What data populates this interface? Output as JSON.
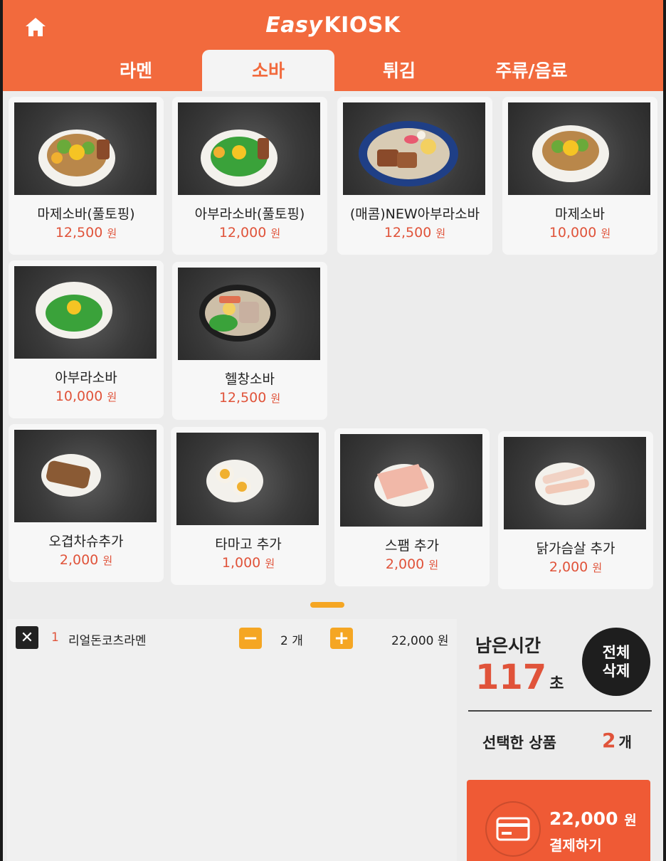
{
  "brand": {
    "easy": "Easy",
    "kiosk": "KIOSK"
  },
  "colors": {
    "accent": "#f26a3d",
    "price": "#e0533a",
    "qty_button": "#f5a623"
  },
  "tabs": [
    {
      "label": "라멘",
      "active": false
    },
    {
      "label": "소바",
      "active": true
    },
    {
      "label": "튀김",
      "active": false
    },
    {
      "label": "주류/음료",
      "active": false
    }
  ],
  "menu": [
    {
      "name": "마제소바(풀토핑)",
      "price": "12,500",
      "unit": "원"
    },
    {
      "name": "아부라소바(풀토핑)",
      "price": "12,000",
      "unit": "원"
    },
    {
      "name": "(매콤)NEW아부라소바",
      "price": "12,500",
      "unit": "원"
    },
    {
      "name": "마제소바",
      "price": "10,000",
      "unit": "원"
    },
    {
      "name": "아부라소바",
      "price": "10,000",
      "unit": "원"
    },
    {
      "name": "헬창소바",
      "price": "12,500",
      "unit": "원"
    },
    {
      "name": "오겹차슈추가",
      "price": "2,000",
      "unit": "원"
    },
    {
      "name": "타마고 추가",
      "price": "1,000",
      "unit": "원"
    },
    {
      "name": "스팸 추가",
      "price": "2,000",
      "unit": "원"
    },
    {
      "name": "닭가슴살 추가",
      "price": "2,000",
      "unit": "원"
    }
  ],
  "cart": {
    "items": [
      {
        "index": "1",
        "name": "리얼돈코츠라멘",
        "qty": "2 개",
        "price": "22,000 원",
        "minus": "−",
        "plus": "+",
        "remove": "✕"
      }
    ]
  },
  "side": {
    "timer_label": "남은시간",
    "timer_value": "117",
    "timer_unit": "초",
    "clear_line1": "전체",
    "clear_line2": "삭제",
    "selected_label": "선택한 상품",
    "selected_count": "2",
    "selected_unit": "개",
    "pay_amount": "22,000",
    "pay_amount_unit": "원",
    "pay_label": "결제하기"
  }
}
